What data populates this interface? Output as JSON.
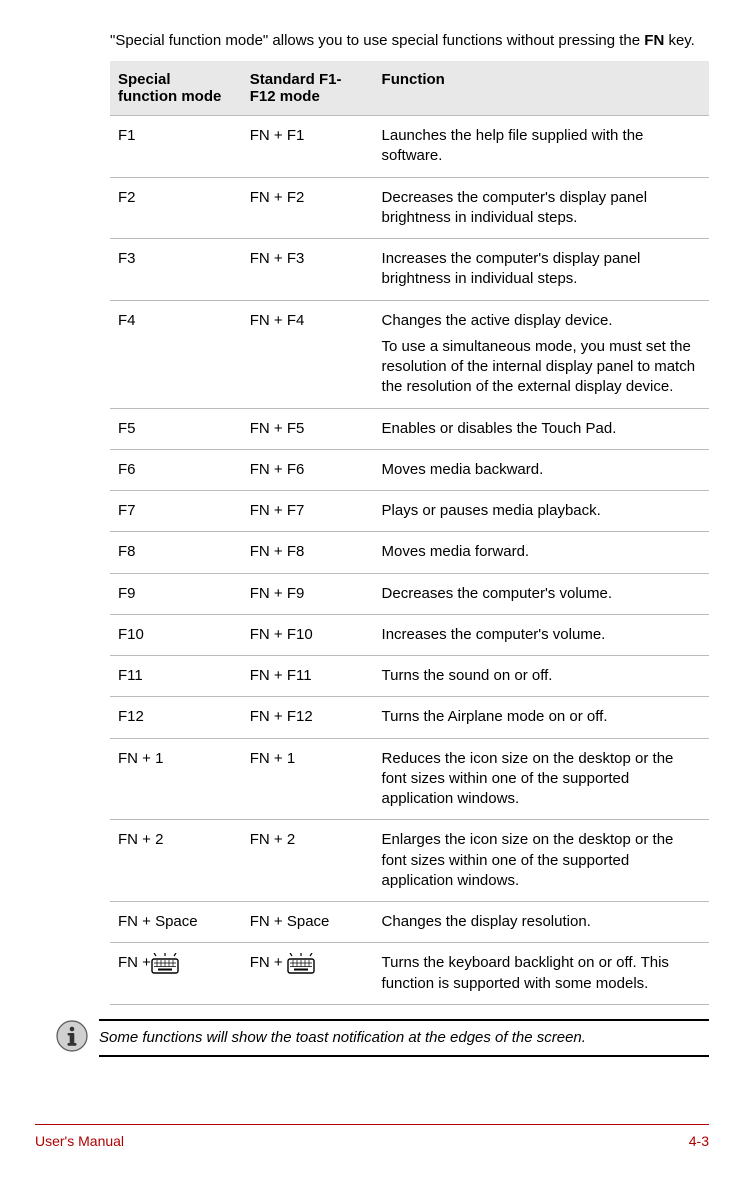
{
  "intro": {
    "part1": "\"Special function mode\" allows you to use special functions without pressing the ",
    "bold": "FN",
    "part2": " key."
  },
  "headers": {
    "col1": "Special function mode",
    "col2": "Standard F1-F12 mode",
    "col3": "Function"
  },
  "rows": [
    {
      "c1": "F1",
      "c2": "FN + F1",
      "c3": "Launches the help file supplied with the software."
    },
    {
      "c1": "F2",
      "c2": "FN + F2",
      "c3": "Decreases the computer's display panel brightness in individual steps."
    },
    {
      "c1": "F3",
      "c2": "FN + F3",
      "c3": "Increases the computer's display panel brightness in individual steps."
    },
    {
      "c1": "F4",
      "c2": "FN + F4",
      "c3": "Changes the active display device.",
      "c3b": "To use a simultaneous mode, you must set the resolution of the internal display panel to match the resolution of the external display device."
    },
    {
      "c1": "F5",
      "c2": "FN + F5",
      "c3": "Enables or disables the Touch Pad."
    },
    {
      "c1": "F6",
      "c2": "FN + F6",
      "c3": "Moves media backward."
    },
    {
      "c1": "F7",
      "c2": "FN + F7",
      "c3": "Plays or pauses media playback."
    },
    {
      "c1": "F8",
      "c2": "FN + F8",
      "c3": "Moves media forward."
    },
    {
      "c1": "F9",
      "c2": "FN + F9",
      "c3": "Decreases the computer's volume."
    },
    {
      "c1": "F10",
      "c2": "FN + F10",
      "c3": "Increases the computer's volume."
    },
    {
      "c1": "F11",
      "c2": "FN + F11",
      "c3": "Turns the sound on or off."
    },
    {
      "c1": "F12",
      "c2": "FN + F12",
      "c3": "Turns the Airplane mode on or off."
    },
    {
      "c1": "FN + 1",
      "c2": "FN + 1",
      "c3": "Reduces the icon size on the desktop or the font sizes within one of the supported application windows."
    },
    {
      "c1": "FN + 2",
      "c2": "FN + 2",
      "c3": "Enlarges the icon size on the desktop or the font sizes within one of the supported application windows."
    },
    {
      "c1": "FN + Space",
      "c2": "FN + Space",
      "c3": "Changes the display resolution."
    },
    {
      "c1": "FN +",
      "c2": "FN + ",
      "c3": "Turns the keyboard backlight on or off. This function is supported with some models.",
      "kbdIcon": true
    }
  ],
  "note": "Some functions will show the toast notification at the edges of the screen.",
  "footer": {
    "left": "User's Manual",
    "right": "4-3"
  }
}
